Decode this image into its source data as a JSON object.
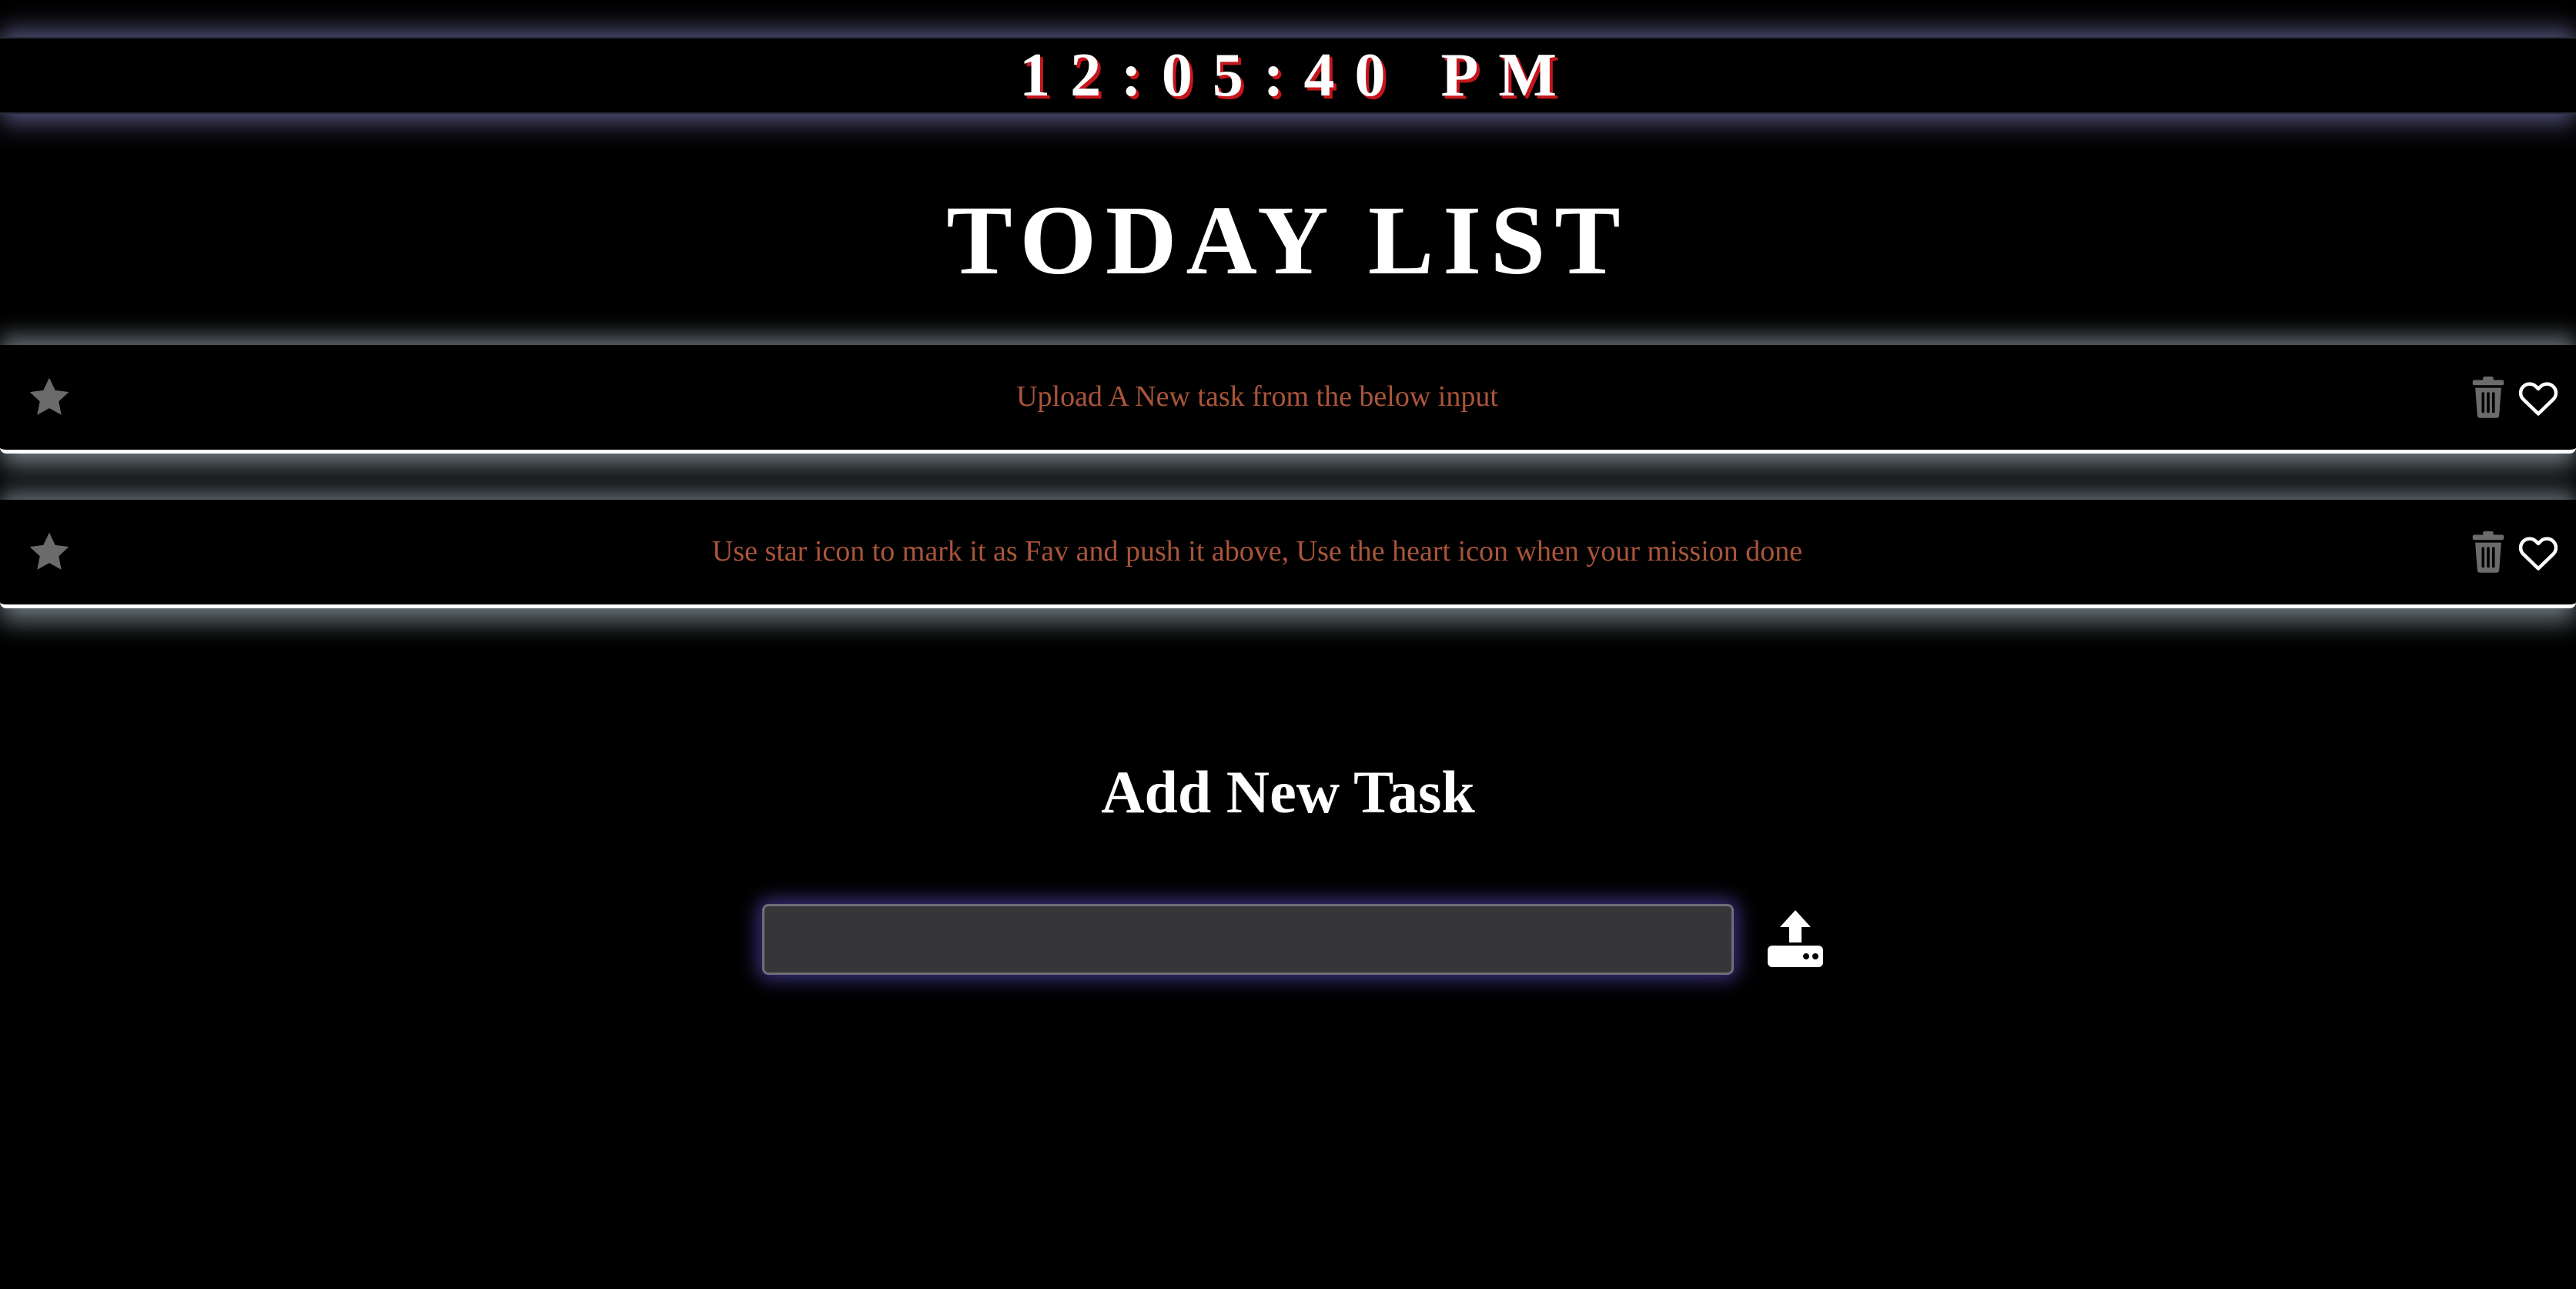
{
  "clock": {
    "time": "12:05:40 PM"
  },
  "header": {
    "title": "TODAY LIST"
  },
  "tasks": [
    {
      "text": "Upload A New task from the below input",
      "star_icon": "star-icon",
      "trash_icon": "trash-icon",
      "heart_icon": "heart-icon"
    },
    {
      "text": "Use star icon to mark it as Fav and push it above, Use the heart icon when your mission done",
      "star_icon": "star-icon",
      "trash_icon": "trash-icon",
      "heart_icon": "heart-icon"
    }
  ],
  "add_task": {
    "heading": "Add New Task",
    "input_value": "",
    "upload_icon": "upload-icon"
  },
  "colors": {
    "background": "#000000",
    "clock_shadow": "#c4161c",
    "task_text": "#a9553a",
    "icon_gray": "#6b6b6b",
    "input_bg": "#363638",
    "input_glow": "#6e5ae6"
  }
}
